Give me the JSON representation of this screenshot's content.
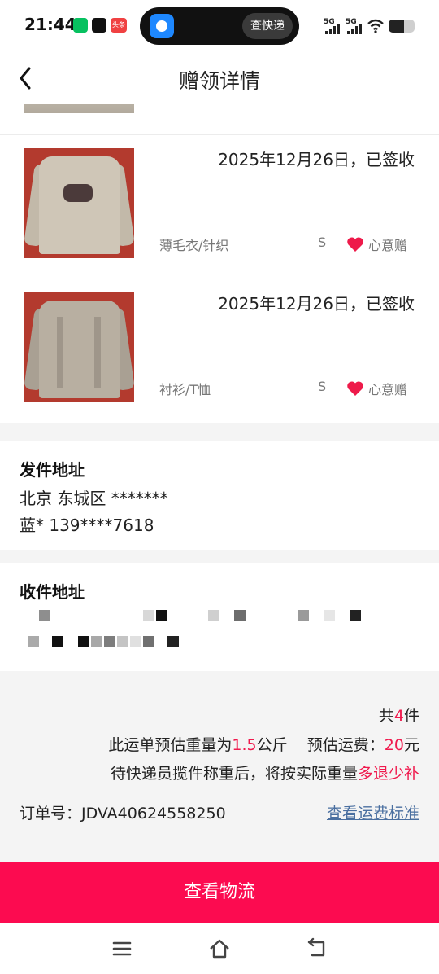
{
  "status_bar": {
    "time": "21:44",
    "notification_icons": [
      "wechat-icon",
      "tiktok-icon",
      "toutiao-icon"
    ],
    "toutiao_label": "头条",
    "island_button": "查快递",
    "signal_1": "5G",
    "signal_2": "5G",
    "battery_level": 0.6
  },
  "header": {
    "back_icon": "chevron-left-icon",
    "title": "赠领详情"
  },
  "items": [
    {
      "date_status": "2025年12月26日，已签收",
      "category": "薄毛衣/针织",
      "size": "S",
      "tag": "心意赠"
    },
    {
      "date_status": "2025年12月26日，已签收",
      "category": "衬衫/T恤",
      "size": "S",
      "tag": "心意赠"
    }
  ],
  "sender": {
    "title": "发件地址",
    "address": "北京 东城区 *******",
    "contact": "蓝* 139****7618"
  },
  "receiver": {
    "title": "收件地址"
  },
  "summary": {
    "count_prefix": "共",
    "count": "4",
    "count_suffix": "件",
    "weight_prefix": "此运单预估重量为",
    "weight": "1.5",
    "weight_unit": "公斤",
    "fee_prefix": "预估运费：",
    "fee": "20",
    "fee_unit": "元",
    "note_prefix": "待快递员揽件称重后，将按实际重量",
    "note_highlight": "多退少补",
    "order_label": "订单号：JDVA40624558250",
    "fee_link": "查看运费标准"
  },
  "cta": {
    "label": "查看物流"
  },
  "colors": {
    "accent": "#fc0b50",
    "link": "#4a6fa0",
    "highlight": "#f0194d"
  },
  "system_nav": [
    "menu-icon",
    "home-icon",
    "back-icon"
  ]
}
